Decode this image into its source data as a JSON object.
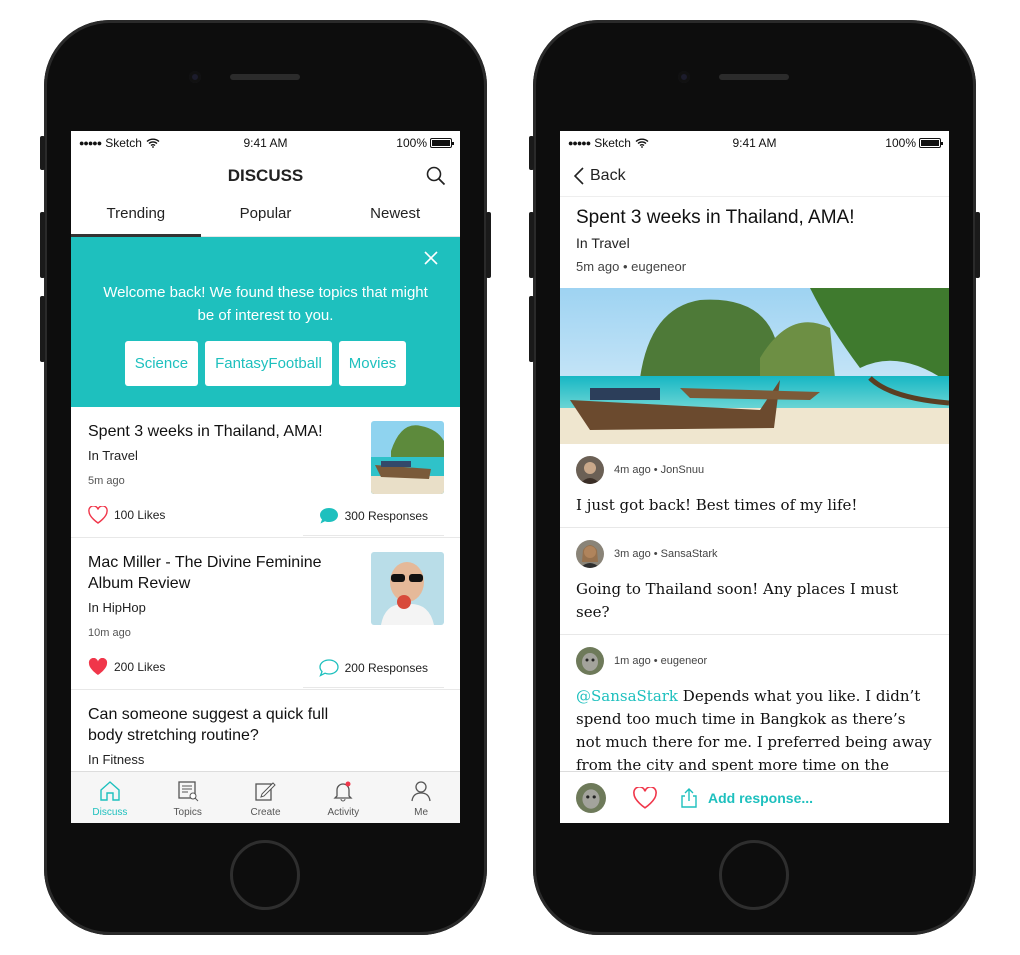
{
  "colors": {
    "accent": "#1ec0be",
    "heart": "#f0364a"
  },
  "status": {
    "carrier": "Sketch",
    "time": "9:41 AM",
    "battery": "100%"
  },
  "left": {
    "title": "DISCUSS",
    "tabs": [
      {
        "label": "Trending"
      },
      {
        "label": "Popular"
      },
      {
        "label": "Newest"
      }
    ],
    "banner": {
      "message": "Welcome back! We found these topics that might be of interest to you.",
      "chips": [
        {
          "label": "Science"
        },
        {
          "label": "FantasyFootball"
        },
        {
          "label": "Movies"
        }
      ]
    },
    "posts": [
      {
        "title": "Spent 3 weeks in Thailand, AMA!",
        "category": "In Travel",
        "age": "5m ago",
        "likes": "100 Likes",
        "responses": "300 Responses",
        "liked": false
      },
      {
        "title": "Mac Miller - The Divine Feminine Album Review",
        "category": "In HipHop",
        "age": "10m ago",
        "likes": "200 Likes",
        "responses": "200 Responses",
        "liked": true
      },
      {
        "title": "Can someone suggest a quick full body stretching routine?",
        "category": "In Fitness"
      }
    ],
    "tabbar": [
      {
        "label": "Discuss",
        "icon": "home-icon"
      },
      {
        "label": "Topics",
        "icon": "topics-icon"
      },
      {
        "label": "Create",
        "icon": "create-icon"
      },
      {
        "label": "Activity",
        "icon": "bell-icon"
      },
      {
        "label": "Me",
        "icon": "user-icon"
      }
    ]
  },
  "right": {
    "back": "Back",
    "post": {
      "title": "Spent 3 weeks in Thailand, AMA!",
      "category": "In Travel",
      "meta": "5m ago • eugeneor"
    },
    "responses": [
      {
        "meta": "4m ago • JonSnuu",
        "text": "I just got back! Best times of my life!"
      },
      {
        "meta": "3m ago • SansaStark",
        "text": "Going to Thailand soon! Any places I must see?"
      },
      {
        "meta": "1m ago • eugeneor",
        "mention": "@SansaStark",
        "text": " Depends what you like. I didn’t spend too much time in Bangkok as there’s not much there for me. I preferred being away from the city and spent more time on the islands."
      }
    ],
    "add_response": "Add response..."
  }
}
